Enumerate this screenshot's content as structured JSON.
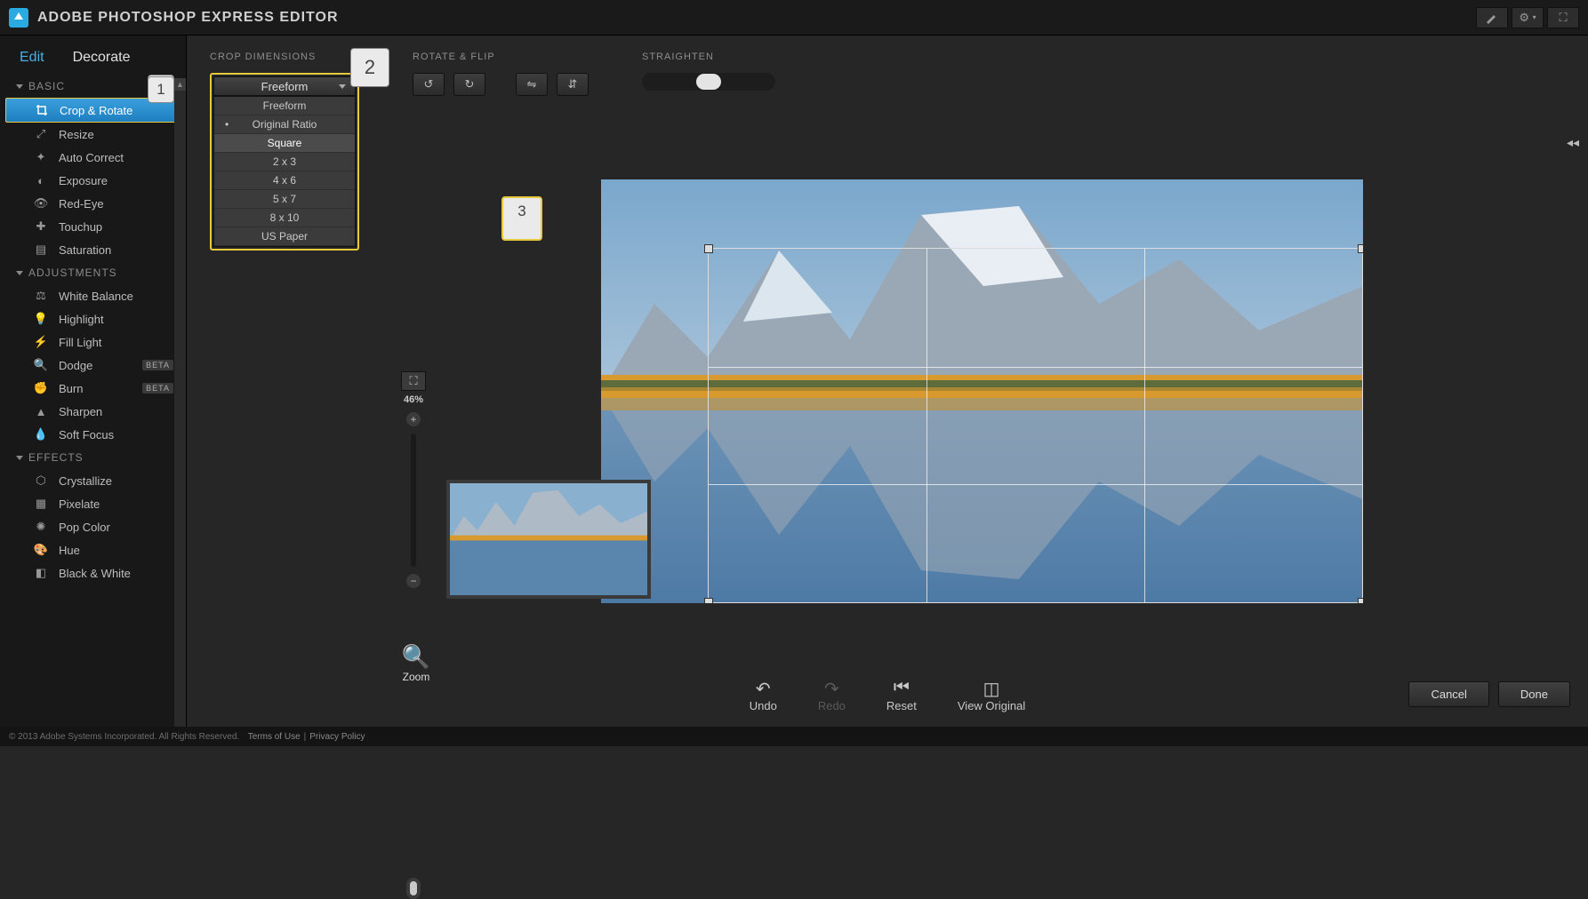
{
  "header": {
    "title": "ADOBE PHOTOSHOP EXPRESS EDITOR"
  },
  "tabs": {
    "edit": "Edit",
    "decorate": "Decorate"
  },
  "groups": {
    "basic": {
      "label": "BASIC",
      "items": [
        "Crop & Rotate",
        "Resize",
        "Auto Correct",
        "Exposure",
        "Red-Eye",
        "Touchup",
        "Saturation"
      ]
    },
    "adjustments": {
      "label": "ADJUSTMENTS",
      "items": [
        "White Balance",
        "Highlight",
        "Fill Light",
        "Dodge",
        "Burn",
        "Sharpen",
        "Soft Focus"
      ]
    },
    "effects": {
      "label": "EFFECTS",
      "items": [
        "Crystallize",
        "Pixelate",
        "Pop Color",
        "Hue",
        "Black & White"
      ]
    }
  },
  "beta_badge": "BETA",
  "optbar": {
    "crop_label": "CROP DIMENSIONS",
    "rotate_label": "ROTATE & FLIP",
    "straighten_label": "STRAIGHTEN",
    "crop_current": "Freeform",
    "crop_options": [
      "Freeform",
      "Original Ratio",
      "Square",
      "2 x 3",
      "4 x 6",
      "5 x 7",
      "8 x 10",
      "US Paper"
    ]
  },
  "zoom": {
    "percent": "46%",
    "label": "Zoom"
  },
  "actions": {
    "undo": "Undo",
    "redo": "Redo",
    "reset": "Reset",
    "view_original": "View Original"
  },
  "buttons": {
    "cancel": "Cancel",
    "done": "Done"
  },
  "callouts": {
    "one": "1",
    "two": "2",
    "three": "3"
  },
  "footer": {
    "copy": "© 2013 Adobe Systems Incorporated. All Rights Reserved.",
    "terms": "Terms of Use",
    "sep": "|",
    "privacy": "Privacy Policy"
  }
}
